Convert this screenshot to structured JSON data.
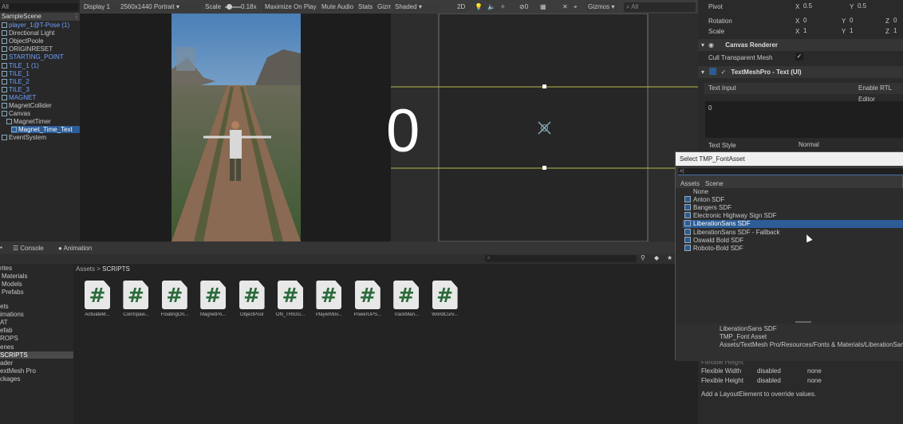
{
  "hierarchy": {
    "search": "All",
    "scene": "SampleScene",
    "items": [
      {
        "label": "player_1@T-Pose (1)",
        "blue": true,
        "indent": 0
      },
      {
        "label": "Directional Light",
        "blue": false,
        "indent": 0
      },
      {
        "label": "ObjectPoole",
        "blue": false,
        "indent": 0
      },
      {
        "label": "ORIGINRESET",
        "blue": false,
        "indent": 0
      },
      {
        "label": "STARTING_POINT",
        "blue": true,
        "indent": 0
      },
      {
        "label": "TILE_1 (1)",
        "blue": true,
        "indent": 0
      },
      {
        "label": "TILE_1",
        "blue": true,
        "indent": 0
      },
      {
        "label": "TILE_2",
        "blue": true,
        "indent": 0
      },
      {
        "label": "TILE_3",
        "blue": true,
        "indent": 0
      },
      {
        "label": "MAGNET",
        "blue": true,
        "indent": 0
      },
      {
        "label": "MagnetCollider",
        "blue": false,
        "indent": 0
      },
      {
        "label": "Canvas",
        "blue": false,
        "indent": 0
      },
      {
        "label": "MagnetTimer",
        "blue": false,
        "indent": 1
      },
      {
        "label": "Magnet_Time_Text",
        "blue": false,
        "indent": 2,
        "selected": true
      },
      {
        "label": "EventSystem",
        "blue": false,
        "indent": 0
      }
    ]
  },
  "game_toolbar": {
    "display": "Display 1",
    "resolution": "2560x1440 Portrait",
    "scale_label": "Scale",
    "scale_value": "0.18x",
    "maximize": "Maximize On Play",
    "mute": "Mute Audio",
    "stats": "Stats",
    "gizmos": "Gizm"
  },
  "scene_toolbar": {
    "shading": "Shaded",
    "mode2d": "2D",
    "gizmos": "Gizmos",
    "search": "All",
    "view_text": "0"
  },
  "inspector": {
    "pivot_label": "Pivot",
    "pivot_x": "0.5",
    "pivot_y": "0.5",
    "rotation_label": "Rotation",
    "rot_x": "0",
    "rot_y": "0",
    "rot_z": "0",
    "scale_label": "Scale",
    "scale_x": "1",
    "scale_y": "1",
    "scale_z": "1",
    "canvas_renderer": "Canvas Renderer",
    "cull": "Cull Transparent Mesh",
    "tmp_title": "TextMeshPro - Text (UI)",
    "text_input": "Text Input",
    "rtl": "Enable RTL Editor",
    "text_value": "0",
    "text_style": "Text Style",
    "text_style_value": "Normal",
    "flex_height_label": "Flexible Height",
    "flex_width_label": "Flexible Width",
    "flex_width_val": "disabled",
    "flex_width_val2": "none",
    "flex_height2_label": "Flexible Height",
    "flex_height_val": "disabled",
    "flex_height_val2": "none",
    "layout_hint": "Add a LayoutElement to override values."
  },
  "bottom_tabs": {
    "project": "",
    "console": "Console",
    "animation": "Animation"
  },
  "project": {
    "favorites": [
      "rites",
      "Materials",
      "Models",
      "Prefabs"
    ],
    "assets": [
      "ets",
      "imations",
      "AT",
      "efab",
      "ROPS",
      "enes",
      "SCRIPTS",
      "ader",
      "extMesh Pro",
      "ckages"
    ],
    "breadcrumb_root": "Assets",
    "breadcrumb_current": "SCRIPTS",
    "files": [
      "ActivateM...",
      "CoinSpaw...",
      "FloatingOri...",
      "MagnetPo...",
      "ObjectPool",
      "ON_TRIGG...",
      "PlayerMov...",
      "PowerUPS...",
      "TrackMan...",
      "WorldCurv..."
    ]
  },
  "font_picker": {
    "title": "Select TMP_FontAsset",
    "tab_assets": "Assets",
    "tab_scene": "Scene",
    "items": [
      "None",
      "Anton SDF",
      "Bangers SDF",
      "Electronic Highway Sign SDF",
      "LiberationSans SDF",
      "LiberationSans SDF - Fallback",
      "Oswald Bold SDF",
      "Roboto-Bold SDF"
    ],
    "selected": "LiberationSans SDF",
    "info_name": "LiberationSans SDF",
    "info_type": "TMP_Font Asset",
    "info_path": "Assets/TextMesh Pro/Resources/Fonts & Materials/LiberationSans"
  }
}
